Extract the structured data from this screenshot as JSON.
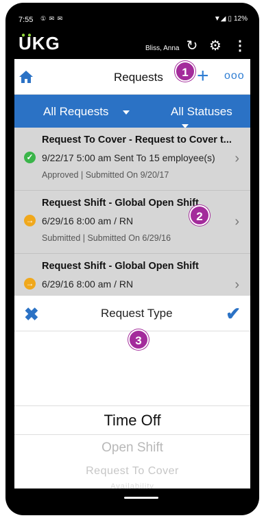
{
  "statusbar": {
    "time": "7:55",
    "notifications": "① ✉ ✉",
    "battery": "12%"
  },
  "appbar": {
    "logo": "UKG",
    "user_name": "Bliss, Anna"
  },
  "header": {
    "title": "Requests",
    "add_label": "+",
    "more_label": "ooo"
  },
  "badges": [
    "1",
    "2",
    "3"
  ],
  "filters": {
    "request_filter": "All Requests",
    "status_filter": "All Statuses"
  },
  "requests": [
    {
      "title": "Request To Cover - Request to Cover t...",
      "detail": "9/22/17 5:00 am Sent To 15 employee(s)",
      "meta": "Approved | Submitted On 9/20/17",
      "status_icon": "check-circle-icon",
      "status_color": "#3bb54a"
    },
    {
      "title": "Request Shift - Global Open Shift",
      "detail": "6/29/16 8:00 am / RN",
      "meta": "Submitted | Submitted On 6/29/16",
      "status_icon": "arrow-circle-icon",
      "status_color": "#f0a81c"
    },
    {
      "title": "Request Shift - Global Open Shift",
      "detail": "6/29/16 8:00 am / RN",
      "meta": "",
      "status_icon": "arrow-circle-icon",
      "status_color": "#f0a81c"
    }
  ],
  "picker": {
    "title": "Request Type",
    "options": [
      "Time Off",
      "Open Shift",
      "Request To Cover",
      "Availability"
    ],
    "selected": "Time Off"
  },
  "colors": {
    "accent": "#2b72c5",
    "badge": "#a32b9b",
    "approved": "#3bb54a",
    "pending": "#f0a81c"
  }
}
